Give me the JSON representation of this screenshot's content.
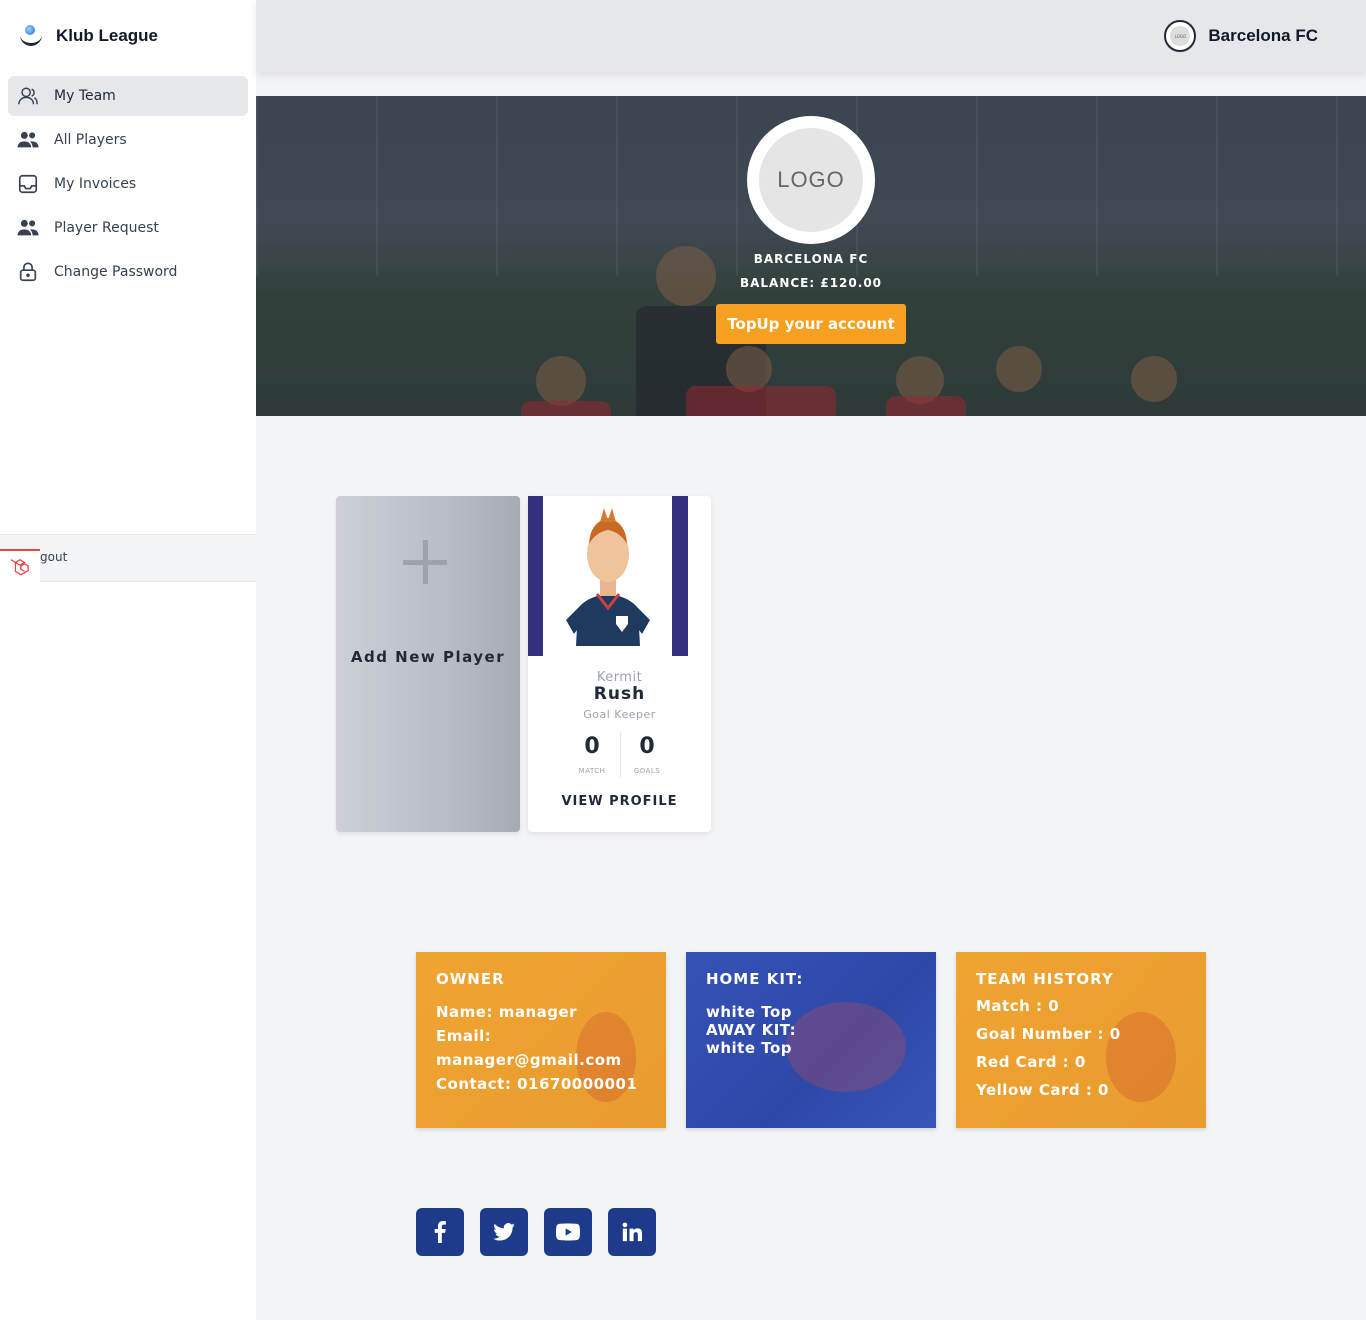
{
  "brand": {
    "name": "Klub League"
  },
  "sidebar": {
    "items": [
      {
        "label": "My Team",
        "icon": "user-icon",
        "active": true
      },
      {
        "label": "All Players",
        "icon": "users-icon"
      },
      {
        "label": "My Invoices",
        "icon": "inbox-icon"
      },
      {
        "label": "Player Request",
        "icon": "users-icon"
      },
      {
        "label": "Change Password",
        "icon": "lock-icon"
      }
    ],
    "logout_label": "gout"
  },
  "header": {
    "club_name": "Barcelona FC",
    "logo_text": "LOGO"
  },
  "hero": {
    "logo_text": "LOGO",
    "club_name": "BARCELONA FC",
    "balance": "BALANCE: £120.00",
    "topup_label": "TopUp your account"
  },
  "players": {
    "add_label": "Add New Player",
    "card": {
      "first_name": "Kermit",
      "last_name": "Rush",
      "position": "Goal Keeper",
      "match_value": "0",
      "match_label": "MATCH",
      "goals_value": "0",
      "goals_label": "GOALS",
      "view_profile": "VIEW PROFILE"
    }
  },
  "owner": {
    "title": "OWNER",
    "name": "Name: manager",
    "email_label": "Email:",
    "email": "manager@gmail.com",
    "contact": "Contact: 01670000001"
  },
  "kit": {
    "title": "HOME KIT:",
    "home": "white Top",
    "away_label": "AWAY KIT:",
    "away": "white Top"
  },
  "history": {
    "title": "TEAM HISTORY",
    "match": "Match : 0",
    "goals": "Goal Number : 0",
    "red": "Red Card : 0",
    "yellow": "Yellow Card : 0"
  },
  "social": [
    "facebook-icon",
    "twitter-icon",
    "youtube-icon",
    "linkedin-icon"
  ],
  "colors": {
    "accent": "#f6a021",
    "navy": "#1e3a8a",
    "kit_blue": "#2e48a8",
    "card_band": "#33307f"
  }
}
